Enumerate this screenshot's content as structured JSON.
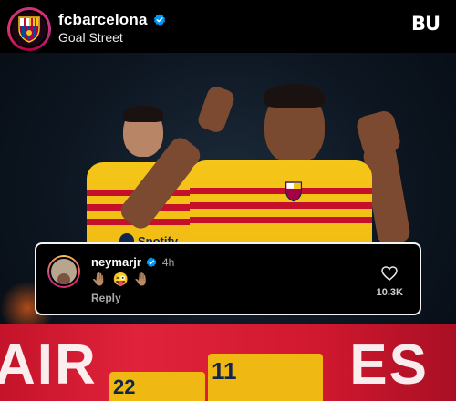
{
  "post": {
    "username": "fcbarcelona",
    "subtitle": "Goal Street",
    "brand_logo": "BU",
    "verified": true
  },
  "photo": {
    "ad_left": "AIR",
    "ad_right": "ES",
    "main_player_number": "11",
    "second_player_number": "22",
    "sponsor": "Spotify"
  },
  "comment": {
    "username": "neymarjr",
    "verified": true,
    "time": "4h",
    "emojis": [
      "🤚🏽",
      "😜",
      "🤚🏽"
    ],
    "reply_label": "Reply",
    "likes": "10.3K"
  },
  "colors": {
    "story_ring": "#c13584",
    "verified_blue": "#0095f6",
    "barca_yellow": "#f5c518",
    "barca_red": "#c4102b"
  },
  "icons": [
    "verified-badge-icon",
    "heart-icon",
    "barcelona-crest-icon"
  ]
}
